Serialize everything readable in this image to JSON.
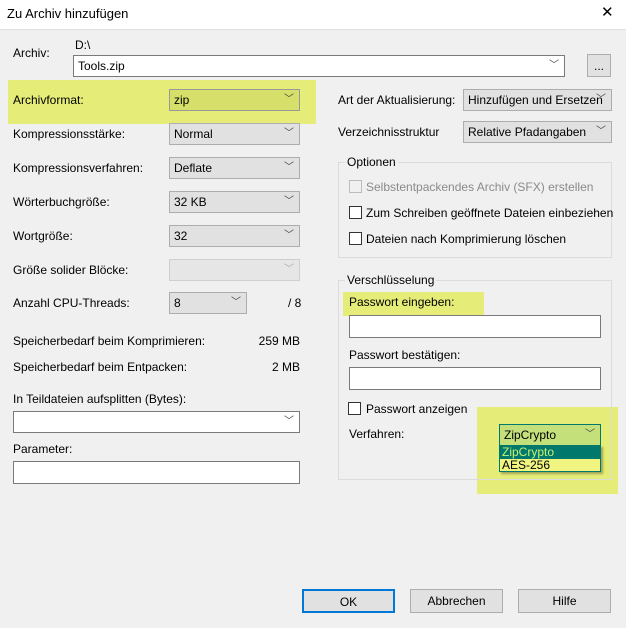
{
  "window": {
    "title": "Zu Archiv hinzufügen",
    "close": "✕"
  },
  "archive": {
    "label": "Archiv:",
    "path": "D:\\",
    "filename": "Tools.zip",
    "browse": "..."
  },
  "left": {
    "format": {
      "label": "Archivformat:",
      "value": "zip"
    },
    "level": {
      "label": "Kompressionsstärke:",
      "value": "Normal"
    },
    "method": {
      "label": "Kompressionsverfahren:",
      "value": "Deflate"
    },
    "dict": {
      "label": "Wörterbuchgröße:",
      "value": "32 KB"
    },
    "word": {
      "label": "Wortgröße:",
      "value": "32"
    },
    "solid": {
      "label": "Größe solider Blöcke:",
      "value": ""
    },
    "threads": {
      "label": "Anzahl CPU-Threads:",
      "value": "8",
      "max": "/ 8"
    },
    "mem_compress": {
      "label": "Speicherbedarf beim Komprimieren:",
      "value": "259 MB"
    },
    "mem_extract": {
      "label": "Speicherbedarf beim Entpacken:",
      "value": "2 MB"
    },
    "split": {
      "label": "In Teildateien aufsplitten (Bytes):",
      "value": ""
    },
    "params": {
      "label": "Parameter:",
      "value": ""
    }
  },
  "right": {
    "update": {
      "label": "Art der Aktualisierung:",
      "value": "Hinzufügen und Ersetzen"
    },
    "paths": {
      "label": "Verzeichnisstruktur",
      "value": "Relative Pfadangaben"
    },
    "options": {
      "title": "Optionen",
      "sfx": "Selbstentpackendes Archiv (SFX) erstellen",
      "open_files": "Zum Schreiben geöffnete Dateien einbeziehen",
      "delete_after": "Dateien nach Komprimierung löschen"
    },
    "encryption": {
      "title": "Verschlüsselung",
      "pw_label": "Passwort eingeben:",
      "pw2_label": "Passwort bestätigen:",
      "show_pw": "Passwort anzeigen",
      "method_label": "Verfahren:",
      "method_value": "ZipCrypto",
      "options": [
        "ZipCrypto",
        "AES-256"
      ]
    }
  },
  "buttons": {
    "ok": "OK",
    "cancel": "Abbrechen",
    "help": "Hilfe"
  },
  "colors": {
    "highlight": "#e3ec6e",
    "selected": "#00786c"
  }
}
